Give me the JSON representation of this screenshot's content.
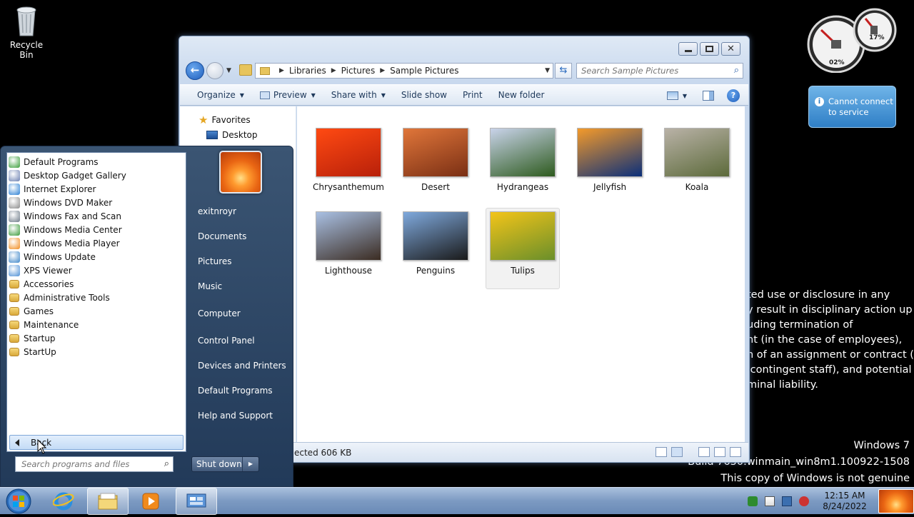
{
  "desktop": {
    "recycle_bin_label": "Recycle Bin",
    "meter_cpu": "02%",
    "meter_mem": "17%",
    "weather_message": "Cannot connect to service",
    "legal_lines": [
      "ted use or disclosure in any",
      "y result in disciplinary action up",
      "uding termination of",
      "nt (in the case of employees),",
      "n of an assignment or contract (in",
      " contingent staff), and potential",
      "minal liability."
    ],
    "windows_version": "Windows 7",
    "build": "Build 7650.winmain_win8m1.100922-1508",
    "genuine_notice": "This copy of Windows is not genuine"
  },
  "explorer": {
    "breadcrumbs": [
      "Libraries",
      "Pictures",
      "Sample Pictures"
    ],
    "search_placeholder": "Search Sample Pictures",
    "toolbar": {
      "organize": "Organize",
      "preview": "Preview",
      "share_with": "Share with",
      "slide_show": "Slide show",
      "print": "Print",
      "new_folder": "New folder"
    },
    "nav": {
      "favorites": "Favorites",
      "desktop": "Desktop"
    },
    "pictures": [
      {
        "name": "Chrysanthemum",
        "palette": [
          "#ff4a12",
          "#b8200a"
        ]
      },
      {
        "name": "Desert",
        "palette": [
          "#e0763a",
          "#7a2f14"
        ]
      },
      {
        "name": "Hydrangeas",
        "palette": [
          "#c9d3ea",
          "#2e5b1e"
        ]
      },
      {
        "name": "Jellyfish",
        "palette": [
          "#f49a2a",
          "#0b2f7a"
        ]
      },
      {
        "name": "Koala",
        "palette": [
          "#b9b2a7",
          "#5c6a3a"
        ]
      },
      {
        "name": "Lighthouse",
        "palette": [
          "#a9c0e3",
          "#3b2c22"
        ]
      },
      {
        "name": "Penguins",
        "palette": [
          "#7fa9dd",
          "#1a1a1a"
        ]
      },
      {
        "name": "Tulips",
        "palette": [
          "#f3c419",
          "#6a8f2a"
        ]
      }
    ],
    "status_text": "ected  606 KB"
  },
  "start_menu": {
    "programs": [
      {
        "label": "Default Programs",
        "icon": "#3a9d3a"
      },
      {
        "label": "Desktop Gadget Gallery",
        "icon": "#6a7fb0"
      },
      {
        "label": "Internet Explorer",
        "icon": "#2a7fd4"
      },
      {
        "label": "Windows DVD Maker",
        "icon": "#8a8a8a"
      },
      {
        "label": "Windows Fax and Scan",
        "icon": "#6d7a88"
      },
      {
        "label": "Windows Media Center",
        "icon": "#3a9a3a"
      },
      {
        "label": "Windows Media Player",
        "icon": "#f08a1c"
      },
      {
        "label": "Windows Update",
        "icon": "#3e86c9"
      },
      {
        "label": "XPS Viewer",
        "icon": "#4c8fd6"
      }
    ],
    "folders": [
      "Accessories",
      "Administrative Tools",
      "Games",
      "Maintenance",
      "Startup",
      "StartUp"
    ],
    "back_label": "Back",
    "search_placeholder": "Search programs and files",
    "right_links": [
      "exitnroyr",
      "Documents",
      "Pictures",
      "Music",
      "Computer",
      "Control Panel",
      "Devices and Printers",
      "Default Programs",
      "Help and Support"
    ],
    "shutdown_label": "Shut down"
  },
  "taskbar": {
    "time": "12:15 AM",
    "date": "8/24/2022"
  }
}
